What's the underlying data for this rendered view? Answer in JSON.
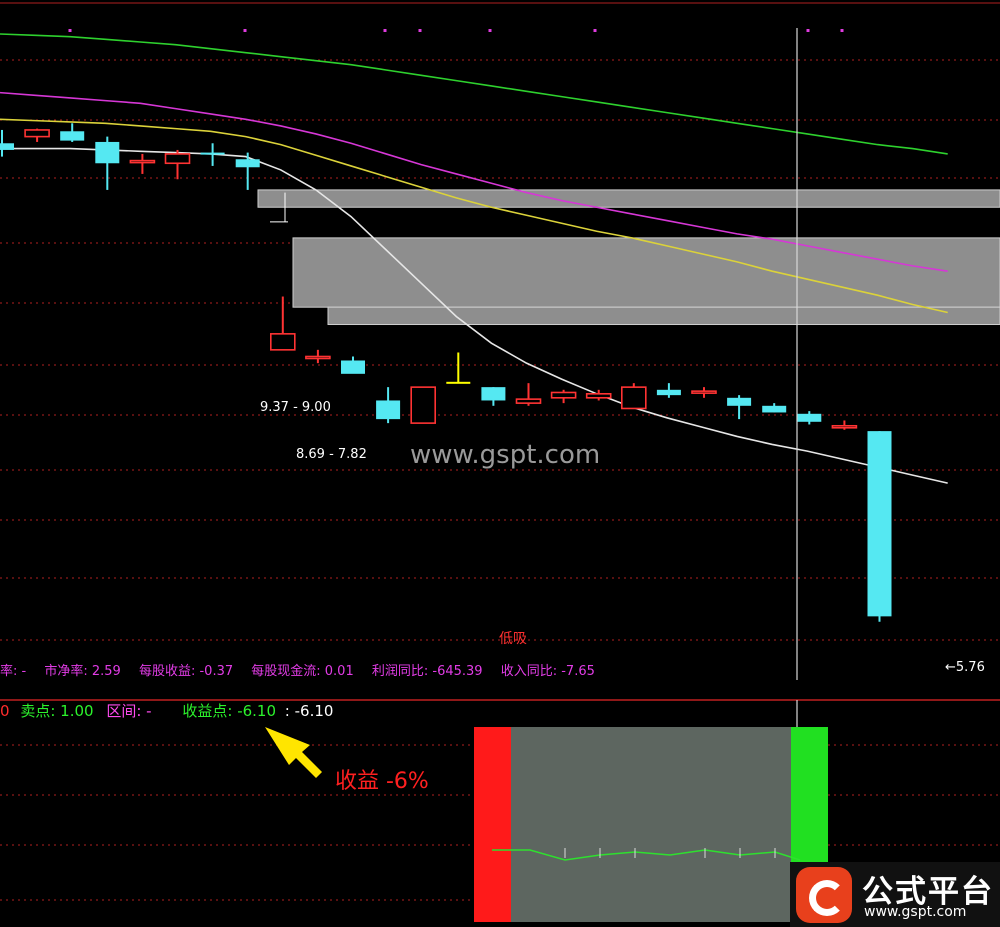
{
  "chart_data": {
    "type": "candlestick",
    "watermark": "www.gspt.com",
    "price_scale": {
      "max": 10.2,
      "min": 5.45
    },
    "moving_averages": [
      {
        "color": "#2ed12e",
        "values": [
          10.17,
          10.16,
          10.15,
          10.13,
          10.11,
          10.09,
          10.06,
          10.03,
          10.0,
          9.97,
          9.94,
          9.9,
          9.86,
          9.82,
          9.78,
          9.74,
          9.7,
          9.66,
          9.62,
          9.58,
          9.54,
          9.5,
          9.46,
          9.42,
          9.38,
          9.34,
          9.31,
          9.27
        ]
      },
      {
        "color": "#d637d6",
        "values": [
          9.73,
          9.71,
          9.69,
          9.67,
          9.65,
          9.61,
          9.57,
          9.53,
          9.48,
          9.42,
          9.35,
          9.27,
          9.19,
          9.12,
          9.05,
          8.98,
          8.92,
          8.87,
          8.82,
          8.77,
          8.72,
          8.67,
          8.63,
          8.58,
          8.53,
          8.48,
          8.43,
          8.39
        ]
      },
      {
        "color": "#dbd23a",
        "values": [
          9.53,
          9.52,
          9.51,
          9.5,
          9.48,
          9.46,
          9.44,
          9.4,
          9.34,
          9.26,
          9.18,
          9.1,
          9.02,
          8.94,
          8.87,
          8.81,
          8.75,
          8.69,
          8.64,
          8.58,
          8.52,
          8.46,
          8.39,
          8.33,
          8.27,
          8.21,
          8.14,
          8.08
        ]
      },
      {
        "color": "#e6e6e6",
        "values": [
          9.31,
          9.31,
          9.31,
          9.3,
          9.29,
          9.28,
          9.27,
          9.25,
          9.15,
          9.0,
          8.8,
          8.55,
          8.3,
          8.05,
          7.85,
          7.7,
          7.58,
          7.47,
          7.37,
          7.29,
          7.22,
          7.15,
          7.09,
          7.04,
          6.98,
          6.92,
          6.86,
          6.8
        ]
      }
    ],
    "candles": [
      {
        "o": 9.35,
        "h": 9.45,
        "l": 9.25,
        "c": 9.3
      },
      {
        "o": 9.4,
        "h": 9.46,
        "l": 9.36,
        "c": 9.45
      },
      {
        "o": 9.44,
        "h": 9.5,
        "l": 9.36,
        "c": 9.37
      },
      {
        "o": 9.36,
        "h": 9.4,
        "l": 9.0,
        "c": 9.2
      },
      {
        "o": 9.22,
        "h": 9.27,
        "l": 9.12,
        "c": 9.22
      },
      {
        "o": 9.2,
        "h": 9.3,
        "l": 9.08,
        "c": 9.27
      },
      {
        "o": 9.28,
        "h": 9.35,
        "l": 9.18,
        "c": 9.27
      },
      {
        "o": 9.23,
        "h": 9.28,
        "l": 9.0,
        "c": 9.17
      },
      {
        "o": 7.8,
        "h": 8.2,
        "l": 7.8,
        "c": 7.92
      },
      {
        "o": 7.75,
        "h": 7.8,
        "l": 7.7,
        "c": 7.75
      },
      {
        "o": 7.72,
        "h": 7.75,
        "l": 7.65,
        "c": 7.62
      },
      {
        "o": 7.42,
        "h": 7.52,
        "l": 7.25,
        "c": 7.28
      },
      {
        "o": 7.25,
        "h": 7.52,
        "l": 7.25,
        "c": 7.52
      },
      {
        "o": 7.56,
        "h": 7.78,
        "l": 7.55,
        "c": 7.56
      },
      {
        "o": 7.52,
        "h": 7.52,
        "l": 7.38,
        "c": 7.42
      },
      {
        "o": 7.4,
        "h": 7.55,
        "l": 7.38,
        "c": 7.43
      },
      {
        "o": 7.44,
        "h": 7.5,
        "l": 7.4,
        "c": 7.48
      },
      {
        "o": 7.44,
        "h": 7.5,
        "l": 7.42,
        "c": 7.47
      },
      {
        "o": 7.36,
        "h": 7.55,
        "l": 7.36,
        "c": 7.52
      },
      {
        "o": 7.5,
        "h": 7.55,
        "l": 7.44,
        "c": 7.46
      },
      {
        "o": 7.48,
        "h": 7.52,
        "l": 7.44,
        "c": 7.49
      },
      {
        "o": 7.44,
        "h": 7.46,
        "l": 7.28,
        "c": 7.38
      },
      {
        "o": 7.38,
        "h": 7.4,
        "l": 7.33,
        "c": 7.33
      },
      {
        "o": 7.32,
        "h": 7.34,
        "l": 7.24,
        "c": 7.26
      },
      {
        "o": 7.23,
        "h": 7.27,
        "l": 7.2,
        "c": 7.23
      },
      {
        "o": 7.19,
        "h": 7.19,
        "l": 5.76,
        "c": 5.8
      }
    ],
    "gap_zones": [
      {
        "label": "9.37 - 9.00",
        "high": 9.0,
        "low": 8.87
      },
      {
        "label": "8.69 - 7.82",
        "high": 8.64,
        "low": 8.12
      },
      {
        "low_tail": 7.99
      }
    ],
    "highlight_candle_label": "低吸",
    "last_price_label": "5.76"
  },
  "fundamentals": {
    "pe": "率: -",
    "pb": "市净率: 2.59",
    "eps": "每股收益: -0.37",
    "cfps": "每股现金流: 0.01",
    "profit_yoy": "利润同比: -645.39",
    "revenue_yoy": "收入同比: -7.65"
  },
  "indicator_bar": {
    "prefix": "0",
    "sell_point": "卖点: 1.00",
    "interval": "区间: -",
    "profit_point": "收益点: -6.10",
    "profit_value": ": -6.10"
  },
  "annotation": {
    "text": "收益 -6%"
  },
  "logo": {
    "title": "公式平台",
    "url": "www.gspt.com"
  },
  "colors": {
    "up": "#ff3333",
    "down": "#55e8f2",
    "highlight": "#ffff00",
    "grid": "#b02020"
  }
}
